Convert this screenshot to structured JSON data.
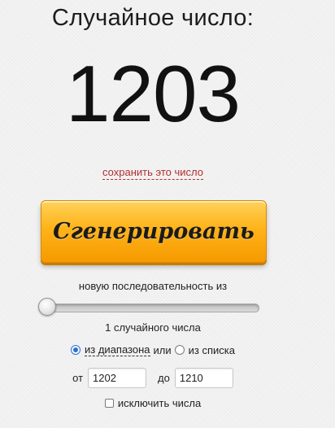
{
  "title": "Случайное число:",
  "result": "1203",
  "save_link": "сохранить это число",
  "generate_button": "Сгенерировать",
  "sequence": {
    "label": "новую последовательность из",
    "count_label": "1 случайного числа",
    "count": 1
  },
  "mode": {
    "range_label": "из диапазона",
    "or_label": "или",
    "list_label": "из списка",
    "selected": "range"
  },
  "range": {
    "from_label": "от",
    "from_value": "1202",
    "to_label": "до",
    "to_value": "1210"
  },
  "exclude": {
    "label": "исключить числа",
    "checked": false
  },
  "colors": {
    "button": "#ffb319",
    "link": "#b03030",
    "radio_accent": "#2a6fd6"
  }
}
